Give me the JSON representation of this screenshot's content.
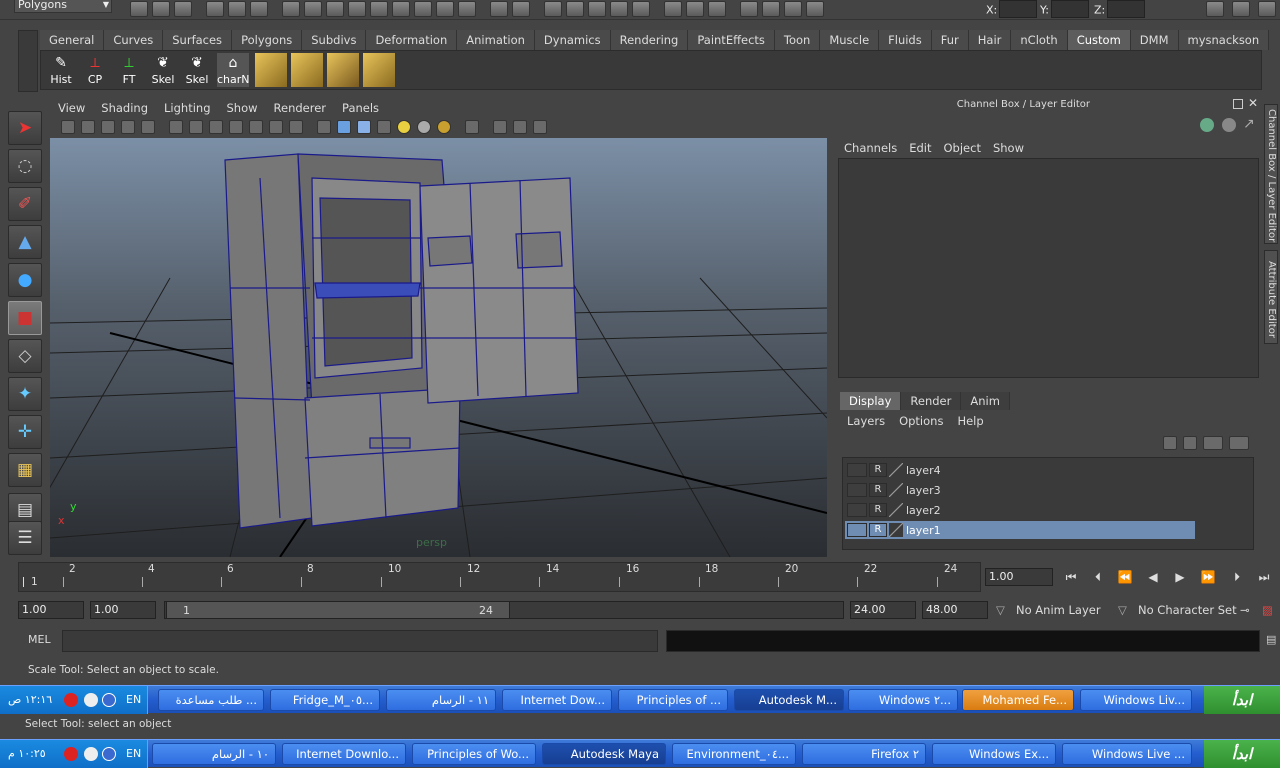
{
  "app": {
    "mode": "Polygons",
    "xyz_labels": [
      "X:",
      "Y:",
      "Z:"
    ]
  },
  "shelf": {
    "tabs": [
      "General",
      "Curves",
      "Surfaces",
      "Polygons",
      "Subdivs",
      "Deformation",
      "Animation",
      "Dynamics",
      "Rendering",
      "PaintEffects",
      "Toon",
      "Muscle",
      "Fluids",
      "Fur",
      "Hair",
      "nCloth",
      "Custom",
      "DMM",
      "mysnackson"
    ],
    "active_tab": "Custom",
    "buttons": [
      "Hist",
      "CP",
      "FT",
      "Skel",
      "Skel",
      "charN"
    ]
  },
  "viewport": {
    "menu": [
      "View",
      "Shading",
      "Lighting",
      "Show",
      "Renderer",
      "Panels"
    ],
    "camera_label": "persp",
    "axis_x": "x",
    "axis_y": "y"
  },
  "channel_box": {
    "title": "Channel Box / Layer Editor",
    "menu": [
      "Channels",
      "Edit",
      "Object",
      "Show"
    ]
  },
  "side_tabs": [
    "Channel Box / Layer Editor",
    "Attribute Editor"
  ],
  "layer_editor": {
    "tabs": [
      "Display",
      "Render",
      "Anim"
    ],
    "active_tab": "Display",
    "menu": [
      "Layers",
      "Options",
      "Help"
    ],
    "layers": [
      {
        "name": "layer4",
        "flag": "R",
        "selected": false
      },
      {
        "name": "layer3",
        "flag": "R",
        "selected": false
      },
      {
        "name": "layer2",
        "flag": "R",
        "selected": false
      },
      {
        "name": "layer1",
        "flag": "R",
        "selected": true
      }
    ]
  },
  "timeline": {
    "tick_labels": [
      "1",
      "2",
      "4",
      "6",
      "8",
      "10",
      "12",
      "14",
      "16",
      "18",
      "20",
      "22",
      "24"
    ],
    "current_frame": "1.00"
  },
  "range": {
    "start": "1.00",
    "playback_start": "1.00",
    "slider_start": "1",
    "slider_end": "24",
    "playback_end": "24.00",
    "end": "48.00",
    "anim_layer": "No Anim Layer",
    "character_set": "No Character Set"
  },
  "mel": {
    "label": "MEL"
  },
  "status": {
    "help_line": "Scale Tool: Select an object to scale.",
    "help_line_2": "Select Tool: select an object"
  },
  "taskbar1": {
    "start": "ابدأ",
    "clock": "١٢:١٦ ص",
    "lang": "EN",
    "tasks": [
      "Windows Liv...",
      "Mohamed Fe...",
      "Windows ٢...",
      "Autodesk M...",
      "Principles of ...",
      "Internet Dow...",
      "١١ - الرسام",
      "Fridge_M_٠٥...",
      "طلب مساعدة ..."
    ]
  },
  "taskbar2": {
    "start": "ابدأ",
    "clock": "١٠:٢٥ م",
    "lang": "EN",
    "tasks": [
      "Windows Live ...",
      "Windows Ex...",
      "Firefox ٢",
      "Environment_٠٤...",
      "Autodesk Maya",
      "Principles of Wo...",
      "Internet Downlo...",
      "١٠ - الرسام"
    ]
  },
  "colors": {
    "viewport_top": "#7b8fa6",
    "viewport_bottom": "#2a2d31",
    "selected_layer": "#6f8db3",
    "taskbar": "#245ecf",
    "wire": "#1a1a8a"
  }
}
